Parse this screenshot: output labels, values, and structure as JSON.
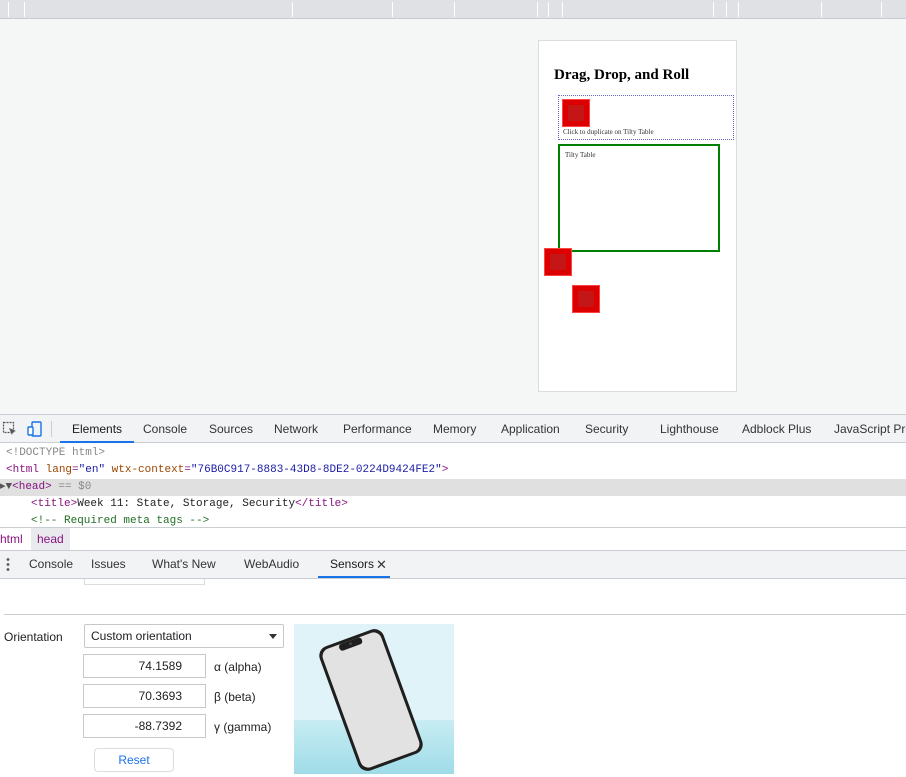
{
  "page": {
    "title": "Drag, Drop, and Roll",
    "source_hint": "Click to duplicate on Tilty Table",
    "tilty_label": "Tilty Table"
  },
  "devtools": {
    "tabs": [
      "Elements",
      "Console",
      "Sources",
      "Network",
      "Performance",
      "Memory",
      "Application",
      "Security",
      "Lighthouse",
      "Adblock Plus",
      "JavaScript Pro"
    ],
    "active_tab": "Elements",
    "code": {
      "doctype": "<!DOCTYPE html>",
      "html_open": "<html",
      "lang_attr": "lang",
      "lang_val": "\"en\"",
      "ctx_attr": "wtx-context",
      "ctx_val": "\"76B0C917-8883-43D8-8DE2-0224D9424FE2\"",
      "html_close": ">",
      "head_tag": "<head>",
      "head_selected": "== $0",
      "title_open": "<title>",
      "title_text": "Week 11: State, Storage, Security",
      "title_close": "</title>",
      "comment": "<!-- Required meta tags -->"
    },
    "breadcrumbs": [
      "html",
      "head"
    ],
    "drawer_tabs": [
      "Console",
      "Issues",
      "What's New",
      "WebAudio",
      "Sensors"
    ],
    "active_drawer_tab": "Sensors"
  },
  "sensors": {
    "orientation_label": "Orientation",
    "orientation_value": "Custom orientation",
    "alpha_value": "74.1589",
    "alpha_label": "α (alpha)",
    "beta_value": "70.3693",
    "beta_label": "β (beta)",
    "gamma_value": "-88.7392",
    "gamma_label": "γ (gamma)",
    "reset_label": "Reset"
  },
  "colors": {
    "accent": "#1a73e8",
    "box_red": "#dd0000",
    "table_green": "#008000"
  }
}
